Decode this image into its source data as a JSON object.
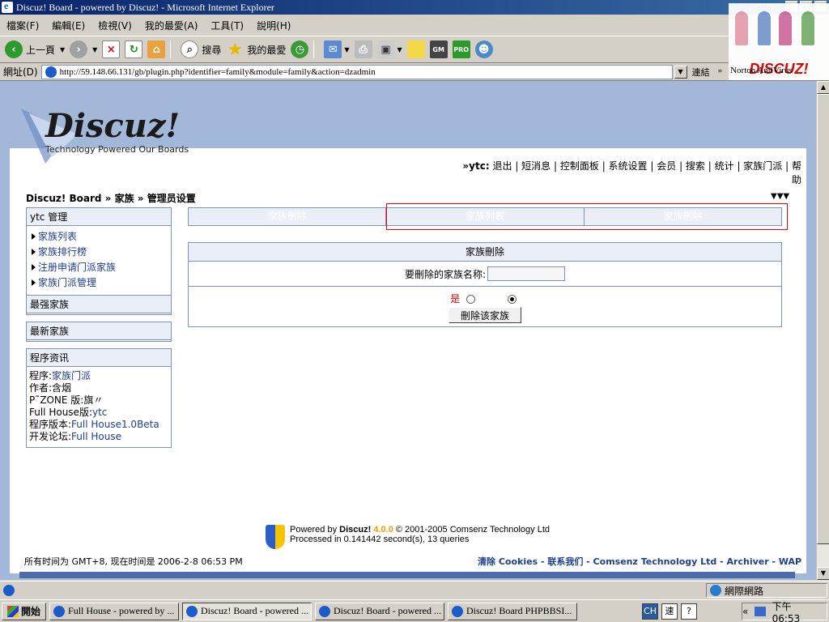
{
  "window": {
    "title": "Discuz! Board - powered by Discuz! - Microsoft Internet Explorer"
  },
  "menu": [
    "檔案(F)",
    "編輯(E)",
    "檢視(V)",
    "我的最愛(A)",
    "工具(T)",
    "說明(H)"
  ],
  "toolbar": {
    "back": "上一頁",
    "search": "搜尋",
    "favorites": "我的最愛"
  },
  "address": {
    "label": "網址(D)",
    "url": "http://59.148.66.131/gb/plugin.php?identifier=family&module=family&action=dzadmin",
    "go": "連結",
    "norton": "Norton AntiVirus"
  },
  "brand_logo": "DISCUZ!",
  "forum": {
    "logo_title": "Discuz!",
    "logo_tagline": "Technology Powered Our Boards",
    "user": "ytc",
    "top_links": [
      "退出",
      "短消息",
      "控制面板",
      "系统设置",
      "会员",
      "搜索",
      "统计",
      "家族门派",
      "帮助"
    ],
    "breadcrumb": "Discuz! Board » 家族 » 管理员设置"
  },
  "sidebar": {
    "admin_title": "ytc 管理",
    "admin_items": [
      "家族列表",
      "家族排行榜",
      "注册申请门派家族",
      "家族门派管理"
    ],
    "strongest": "最强家族",
    "newest": "最新家族",
    "info_title": "程序资讯",
    "info": [
      {
        "k": "程序:",
        "v": "家族门派"
      },
      {
        "k": "作者:",
        "v": "含烟"
      },
      {
        "k": "P˜ZONE 版:旗〃",
        "v": ""
      },
      {
        "k": "Full House版:",
        "v": "ytc"
      },
      {
        "k": "程序版本:",
        "v": "Full House1.0Beta"
      },
      {
        "k": "开发论坛:",
        "v": "Full House"
      }
    ]
  },
  "tabs": [
    "家族刪除",
    "家族列表",
    "家族刪除"
  ],
  "delete": {
    "header": "家族刪除",
    "name_label": "要刪除的家族名称:",
    "name_value": "",
    "yes": "是",
    "button": "刪除该家族"
  },
  "footer": {
    "powered_prefix": "Powered by ",
    "brand": "Discuz!",
    "version": "4.0.0",
    "copyright": "© 2001-2005 Comsenz Technology Ltd",
    "processed": "Processed in 0.141442 second(s), 13 queries",
    "time_text": "所有时间为  GMT+8, 现在时间是   2006-2-8 06:53 PM",
    "right_links": "清除  Cookies - 联系我们  - Comsenz Technology Ltd - Archiver - WAP"
  },
  "statusbar": {
    "zone": "網際網路"
  },
  "taskbar": {
    "start": "開始",
    "tasks": [
      "Full House - powered by ...",
      "Discuz! Board - powered ...",
      "Discuz! Board - powered ...",
      "Discuz! Board PHPBBSI..."
    ],
    "active_index": 1,
    "tray_ime": "CH",
    "tray_ime2": "速",
    "clock": "下午 06:53"
  }
}
